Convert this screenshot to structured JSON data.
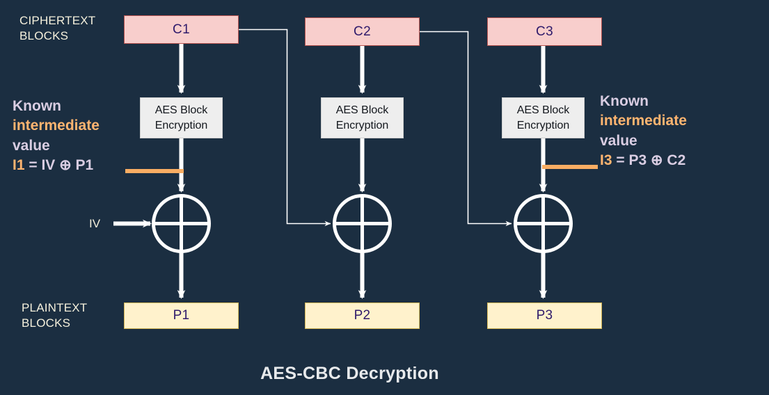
{
  "diagram": {
    "title": "AES-CBC Decryption",
    "background_color": "#1b2e41",
    "labels": {
      "ciphertext_blocks": "CIPHERTEXT\nBLOCKS",
      "ciphertext_line1": "CIPHERTEXT",
      "ciphertext_line2": "BLOCKS",
      "plaintext_line1": "PLAINTEXT",
      "plaintext_line2": "BLOCKS",
      "iv": "IV"
    },
    "ciphertext_blocks": [
      {
        "label": "C1"
      },
      {
        "label": "C2"
      },
      {
        "label": "C3"
      }
    ],
    "cipher_fill": "#f8cecc",
    "cipher_stroke": "#b85450",
    "aes_blocks": [
      {
        "line1": "AES Block",
        "line2": "Encryption"
      },
      {
        "line1": "AES Block",
        "line2": "Encryption"
      },
      {
        "line1": "AES Block",
        "line2": "Encryption"
      }
    ],
    "aes_fill": "#eeeeee",
    "aes_stroke": "#cccccc",
    "plaintext_blocks": [
      {
        "label": "P1"
      },
      {
        "label": "P2"
      },
      {
        "label": "P3"
      }
    ],
    "plain_fill": "#fff2cc",
    "plain_stroke": "#d6b656",
    "xor_symbol": "⊕",
    "notes": [
      {
        "line1": "Known",
        "line2": "intermediate",
        "line3": "value",
        "formula_var": "I1",
        "formula_rest": " = IV ⊕ P1",
        "highlight_color": "#ffb570",
        "text_color": "#d9cde2"
      },
      {
        "line1": "Known",
        "line2": "intermediate",
        "line3": "value",
        "formula_var": "I3",
        "formula_rest": " = P3 ⊕ C2",
        "highlight_color": "#ffb570",
        "text_color": "#d9cde2"
      }
    ],
    "wire_color": "#ffffff",
    "marker_color": "#f9ad63"
  }
}
